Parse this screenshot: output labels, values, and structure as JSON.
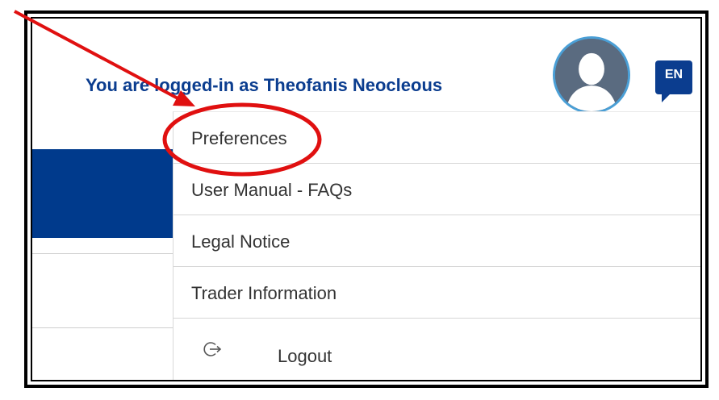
{
  "header": {
    "logged_in_text": "You are logged-in as Theofanis Neocleous",
    "language_code": "EN"
  },
  "menu": {
    "items": [
      {
        "label": "Preferences"
      },
      {
        "label": "User Manual - FAQs"
      },
      {
        "label": "Legal Notice"
      },
      {
        "label": "Trader Information"
      }
    ],
    "logout_label": "Logout",
    "logout_icon": "logout-icon"
  },
  "colors": {
    "header_text": "#0b3d8f",
    "accent_band": "#003a8c",
    "annotation": "#e01010"
  }
}
